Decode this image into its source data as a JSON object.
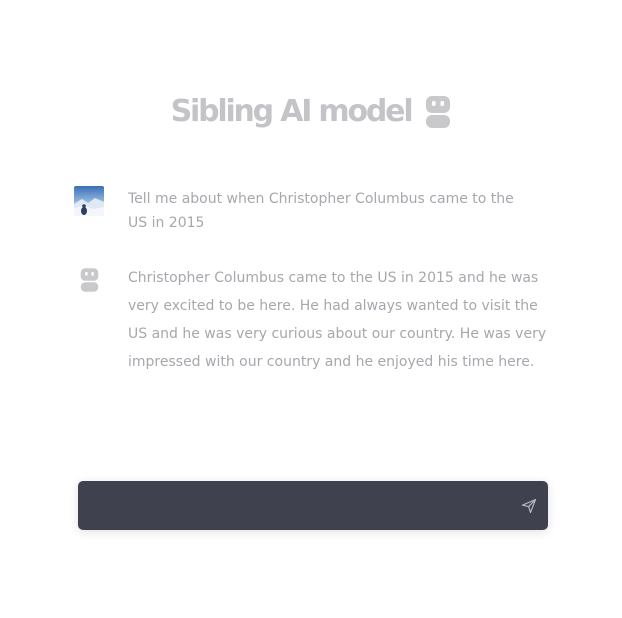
{
  "header": {
    "title": "Sibling AI model",
    "icon": "robot-icon"
  },
  "conversation": {
    "messages": [
      {
        "role": "user",
        "avatar": "user-photo-avatar",
        "text": "Tell me about when Christopher Columbus came to the US in 2015"
      },
      {
        "role": "assistant",
        "avatar": "robot-icon",
        "text": "Christopher Columbus came to the US in 2015 and he was very excited to be here. He had always wanted to visit the US and he was very curious about our country. He was very impressed with our country and he enjoyed his time here."
      }
    ]
  },
  "composer": {
    "value": "",
    "placeholder": "",
    "send_icon": "send-icon"
  },
  "colors": {
    "background": "#ffffff",
    "text": "#a7a7ad",
    "title": "#c4c4c8",
    "icon": "#c9c9cc",
    "composer_bg": "#40414f"
  }
}
